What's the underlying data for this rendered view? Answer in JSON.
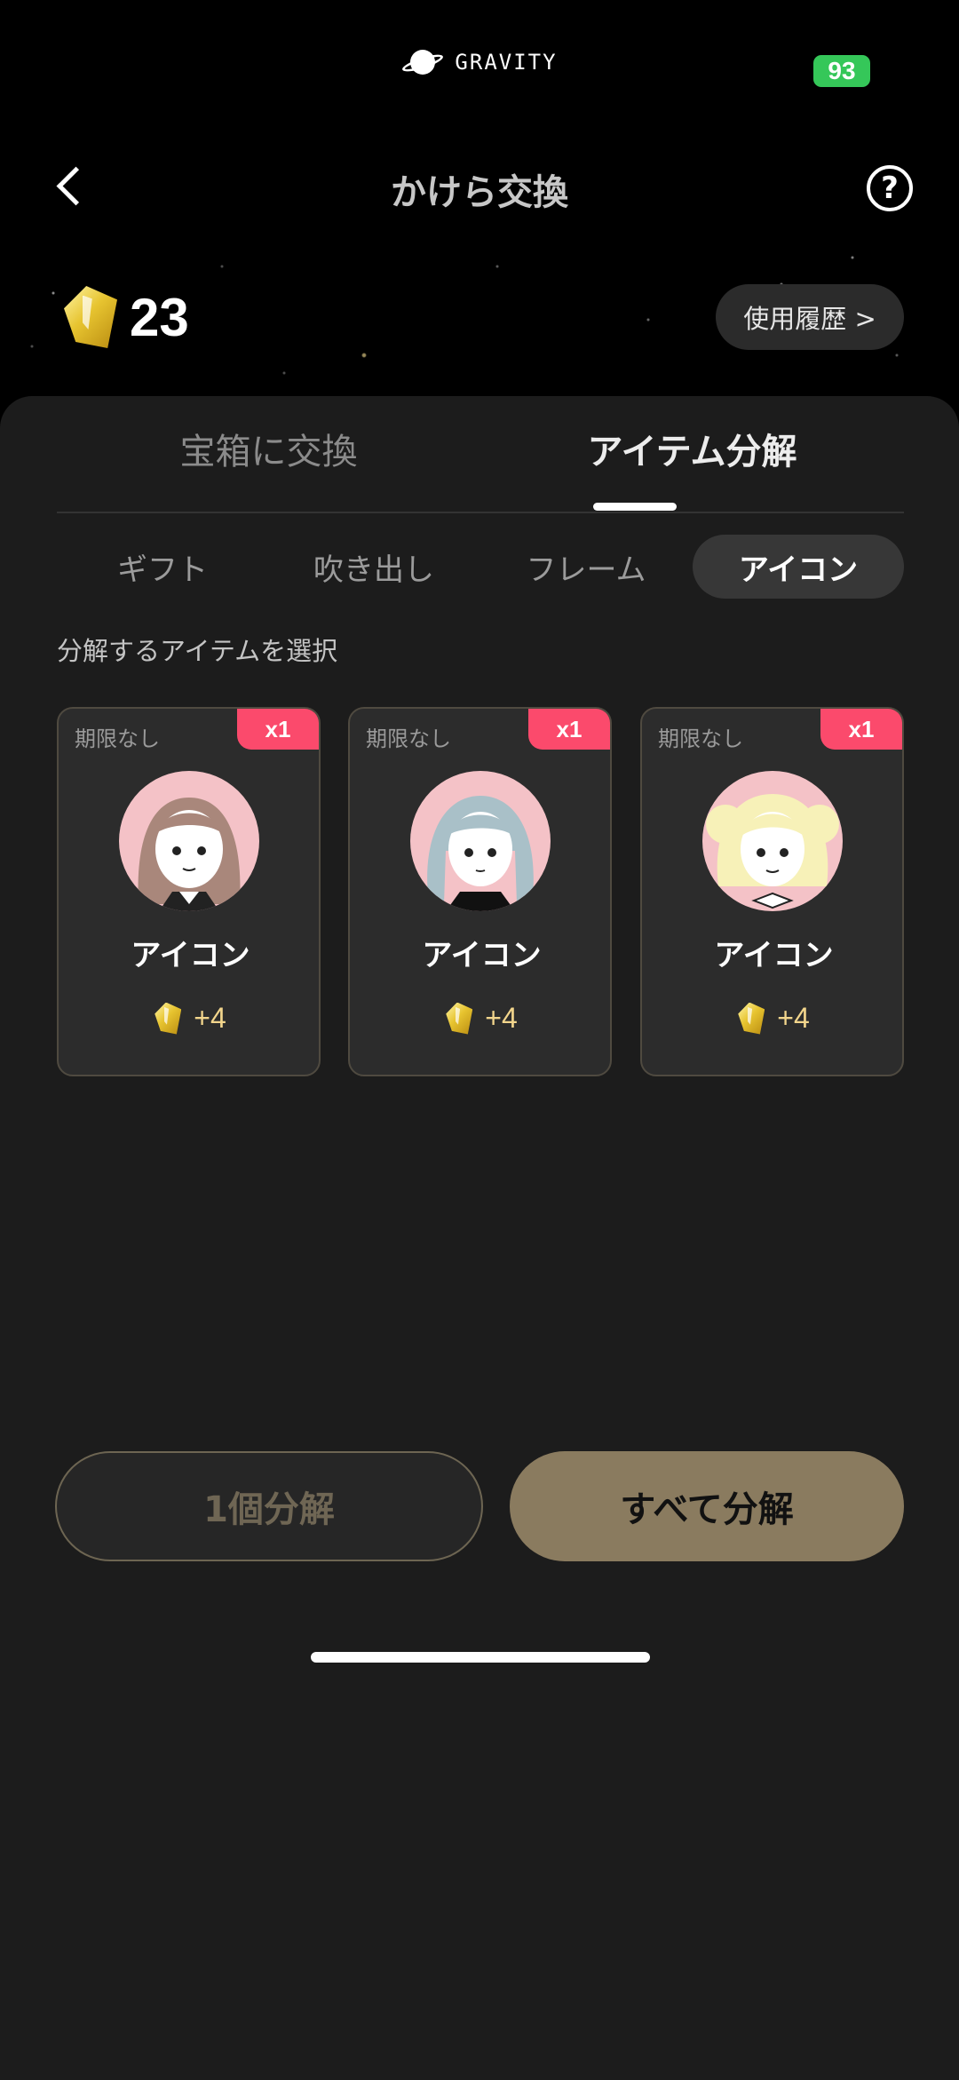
{
  "status_bar": {
    "app_logo_text": "GRAVITY",
    "battery": "93"
  },
  "header": {
    "title": "かけら交換"
  },
  "balance": {
    "value": "23"
  },
  "history_button": {
    "label": "使用履歴 >"
  },
  "main_tabs": [
    {
      "label": "宝箱に交換",
      "active": false
    },
    {
      "label": "アイテム分解",
      "active": true
    }
  ],
  "sub_tabs": [
    {
      "label": "ギフト",
      "active": false
    },
    {
      "label": "吹き出し",
      "active": false
    },
    {
      "label": "フレーム",
      "active": false
    },
    {
      "label": "アイコン",
      "active": true
    }
  ],
  "section_label": "分解するアイテムを選択",
  "items": [
    {
      "limit": "期限なし",
      "count": "x1",
      "name": "アイコン",
      "reward": "+4",
      "hair_color": "#a9877b"
    },
    {
      "limit": "期限なし",
      "count": "x1",
      "name": "アイコン",
      "reward": "+4",
      "hair_color": "#a9c0c8"
    },
    {
      "limit": "期限なし",
      "count": "x1",
      "name": "アイコン",
      "reward": "+4",
      "hair_color": "#f7f1b8"
    }
  ],
  "actions": {
    "decompose_one": "1個分解",
    "decompose_all": "すべて分解"
  },
  "colors": {
    "accent_gold": "#8a7b5f",
    "badge_pink": "#fb4a6c",
    "battery_green": "#35c759"
  }
}
